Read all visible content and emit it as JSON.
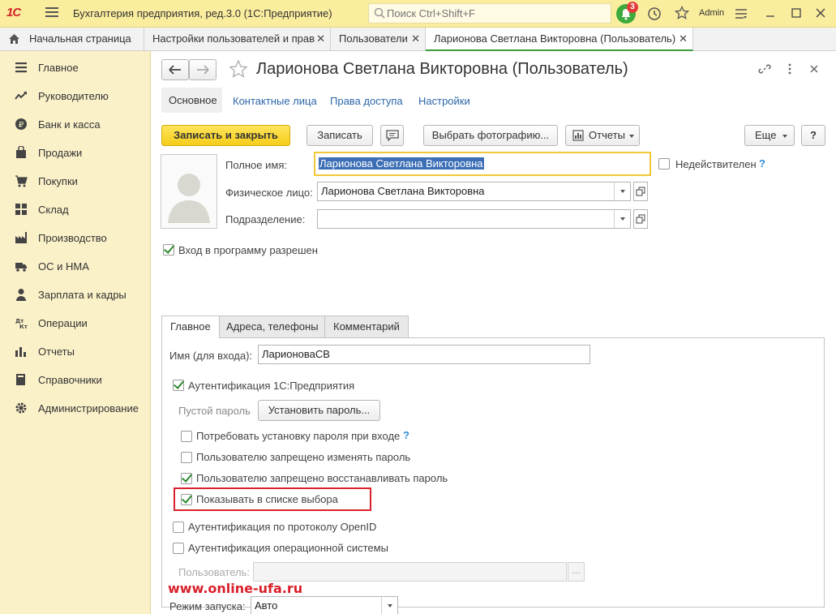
{
  "titlebar": {
    "logo": "1С",
    "app_title": "Бухгалтерия предприятия, ред.3.0  (1С:Предприятие)",
    "search_placeholder": "Поиск Ctrl+Shift+F",
    "notification_count": "3",
    "user": "Admin"
  },
  "tabs": [
    {
      "label": "Начальная страница"
    },
    {
      "label": "Настройки пользователей и прав"
    },
    {
      "label": "Пользователи"
    },
    {
      "label": "Ларионова Светлана Викторовна (Пользователь)"
    }
  ],
  "sidebar": {
    "items": [
      {
        "label": "Главное",
        "icon": "menu-icon"
      },
      {
        "label": "Руководителю",
        "icon": "trend-icon"
      },
      {
        "label": "Банк и касса",
        "icon": "ruble-icon"
      },
      {
        "label": "Продажи",
        "icon": "bag-icon"
      },
      {
        "label": "Покупки",
        "icon": "cart-icon"
      },
      {
        "label": "Склад",
        "icon": "warehouse-icon"
      },
      {
        "label": "Производство",
        "icon": "factory-icon"
      },
      {
        "label": "ОС и НМА",
        "icon": "truck-icon"
      },
      {
        "label": "Зарплата и кадры",
        "icon": "person-icon"
      },
      {
        "label": "Операции",
        "icon": "dt-kt-icon"
      },
      {
        "label": "Отчеты",
        "icon": "bar-chart-icon"
      },
      {
        "label": "Справочники",
        "icon": "book-icon"
      },
      {
        "label": "Администрирование",
        "icon": "gear-icon"
      }
    ]
  },
  "form": {
    "title": "Ларионова Светлана Викторовна (Пользователь)",
    "nav": {
      "main": "Основное",
      "contacts": "Контактные лица",
      "rights": "Права доступа",
      "settings": "Настройки"
    },
    "toolbar": {
      "save_close": "Записать и закрыть",
      "save": "Записать",
      "choose_photo": "Выбрать фотографию...",
      "reports": "Отчеты",
      "more": "Еще",
      "help": "?"
    },
    "full_name_label": "Полное имя:",
    "full_name_value": "Ларионова Светлана Викторовна",
    "invalid_label": "Недействителен",
    "person_label": "Физическое лицо:",
    "person_value": "Ларионова Светлана Викторовна",
    "department_label": "Подразделение:",
    "department_value": "",
    "login_allowed": "Вход в программу разрешен",
    "subtabs": [
      "Главное",
      "Адреса, телефоны",
      "Комментарий"
    ],
    "login_name_label": "Имя (для входа):",
    "login_name_value": "ЛарионоваСВ",
    "auth_1c": "Аутентификация 1С:Предприятия",
    "empty_password": "Пустой пароль",
    "set_password": "Установить пароль...",
    "require_password": "Потребовать установку пароля при входе",
    "forbid_change": "Пользователю запрещено изменять пароль",
    "forbid_restore": "Пользователю запрещено восстанавливать пароль",
    "show_in_list": "Показывать в списке выбора",
    "auth_openid": "Аутентификация по протоколу OpenID",
    "auth_os": "Аутентификация операционной системы",
    "os_user_label": "Пользователь:",
    "launch_mode_label": "Режим запуска:",
    "launch_mode_value": "Авто",
    "watermark": "www.online-ufa.ru"
  },
  "colors": {
    "accent_yellow": "#f5cd19",
    "highlight_red": "#d9202b",
    "link_blue": "#2b66a8",
    "check_green": "#2e8b2e"
  }
}
